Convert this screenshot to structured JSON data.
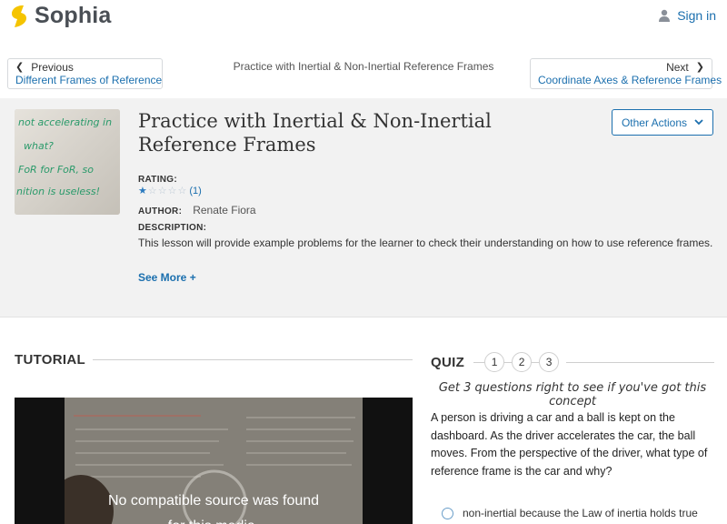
{
  "header": {
    "brand": "Sophia",
    "signin_label": "Sign in",
    "brand_color": "#f5c400"
  },
  "nav": {
    "prev_dir": "Previous",
    "prev_link": "Different Frames of Reference",
    "center_title": "Practice with Inertial & Non-Inertial Reference Frames",
    "next_dir": "Next",
    "next_link": "Coordinate Axes & Reference Frames"
  },
  "lesson": {
    "title": "Practice with Inertial & Non-Inertial Reference Frames",
    "other_actions": "Other Actions",
    "rating_label": "RATING:",
    "rating_stars": 1,
    "rating_max": 5,
    "rating_count": "(1)",
    "author_label": "AUTHOR:",
    "author_name": "Renate Fiora",
    "description_label": "DESCRIPTION:",
    "description": "This lesson will provide example problems for the learner to check their understanding on how to use reference frames.",
    "see_more": "See More +",
    "thumb_lines": [
      "not accelerating in",
      "what?",
      "FoR for FoR, so",
      "nition is useless!"
    ]
  },
  "tutorial": {
    "heading": "TUTORIAL",
    "video_message_1": "No compatible source was found",
    "video_message_2": "for this media."
  },
  "quiz": {
    "heading": "QUIZ",
    "numbers": [
      "1",
      "2",
      "3"
    ],
    "tagline": "Get 3 questions right to see if you've got this concept",
    "question": "A person is driving a car and a ball is kept on the dashboard. As the driver accelerates the car, the ball moves. From the perspective of the driver, what type of reference frame is the car and why?",
    "answers": [
      "non-inertial because the Law of inertia holds true"
    ]
  },
  "colors": {
    "link": "#1b6fae",
    "hero_bg": "#f2f2f2"
  }
}
